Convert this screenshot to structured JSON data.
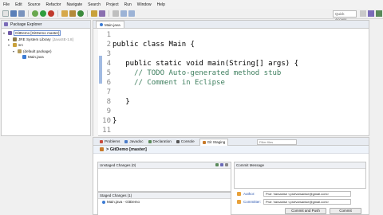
{
  "menu": [
    "File",
    "Edit",
    "Source",
    "Refactor",
    "Navigate",
    "Search",
    "Project",
    "Run",
    "Window",
    "Help"
  ],
  "quick_access": "Quick Access",
  "package_explorer": {
    "title": "Package Explorer",
    "items": [
      {
        "label": "GitDemo [GitDemo master]",
        "indent": 0,
        "twist": "▾",
        "icon": "#6f5aa8",
        "sel": true
      },
      {
        "label": "JRE System Library",
        "suffix": " [JavaSE-1.8]",
        "indent": 1,
        "twist": "▸",
        "icon": "#8c7a4a"
      },
      {
        "label": "src",
        "indent": 1,
        "twist": "▾",
        "icon": "#c9a13b"
      },
      {
        "label": "(default package)",
        "indent": 2,
        "twist": "▾",
        "icon": "#b39b5c"
      },
      {
        "label": "Main.java",
        "indent": 3,
        "twist": "",
        "icon": "#3b7bd4"
      }
    ]
  },
  "editor": {
    "tab": "Main.java",
    "lines": [
      {
        "n": "1",
        "text": "",
        "cls": ""
      },
      {
        "n": "2",
        "text": "public class Main {",
        "cls": "kw"
      },
      {
        "n": "3",
        "text": "",
        "cls": ""
      },
      {
        "n": "4",
        "text": "   public static void main(String[] args) {",
        "cls": "kw"
      },
      {
        "n": "5",
        "text": "     // TODO Auto-generated method stub",
        "cls": "cm"
      },
      {
        "n": "6",
        "text": "     // Comment in Eclipse",
        "cls": "cm"
      },
      {
        "n": "7",
        "text": "",
        "cls": ""
      },
      {
        "n": "8",
        "text": "   }",
        "cls": "kw"
      },
      {
        "n": "9",
        "text": "",
        "cls": ""
      },
      {
        "n": "10",
        "text": "}",
        "cls": "kw"
      },
      {
        "n": "11",
        "text": "",
        "cls": ""
      }
    ]
  },
  "bottom": {
    "tabs": [
      {
        "label": "Problems",
        "color": "#c84a3a"
      },
      {
        "label": "Javadoc",
        "color": "#4a7bc8"
      },
      {
        "label": "Declaration",
        "color": "#5a8a5a"
      },
      {
        "label": "Console",
        "color": "#555555"
      },
      {
        "label": "Git Staging",
        "color": "#c87a2a",
        "active": true
      }
    ],
    "filter_placeholder": "Filter files",
    "repo_title": "> GitDemo [master]",
    "unstaged": "Unstaged Changes (0)",
    "staged": "Staged Changes (1)",
    "staged_file": "Main.java - GitDemo",
    "commit_message": "Commit Message",
    "author_label": "Author:",
    "author_value": "Prof. Varsanise <profvarsanise@gmail.com>",
    "committer_label": "Committer:",
    "committer_value": "Prof. Varsanise <profvarsanise@gmail.com>",
    "commit_push_btn": "Commit and Push",
    "commit_btn": "Commit"
  }
}
